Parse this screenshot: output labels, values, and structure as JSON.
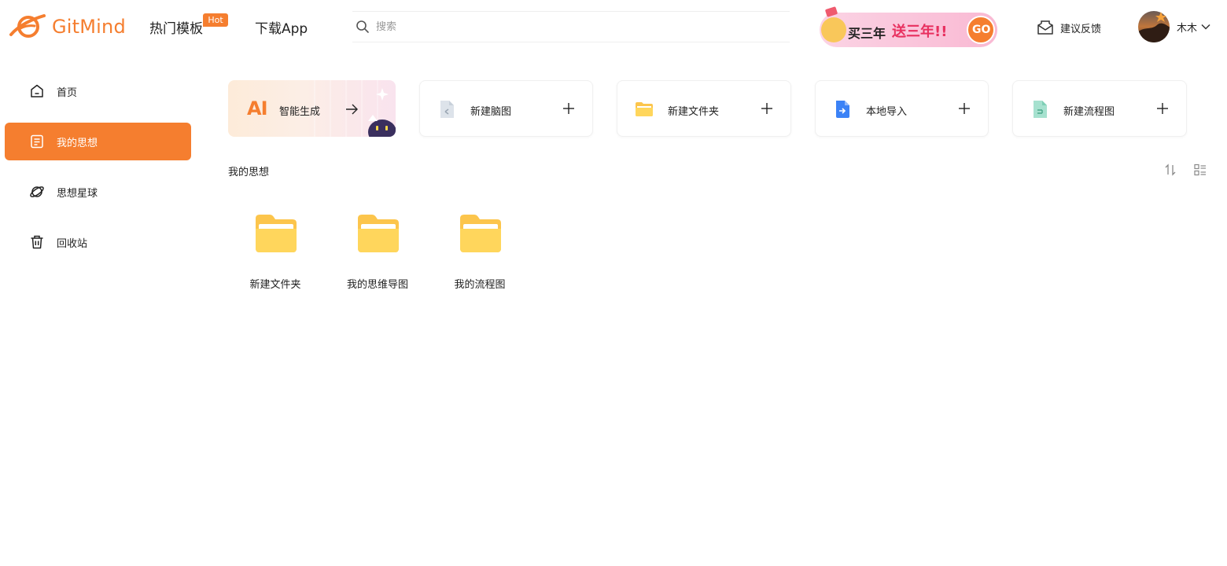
{
  "brand": {
    "name": "GitMind",
    "accent": "#f57e2f"
  },
  "nav": {
    "templates": "热门模板",
    "hot_badge": "Hot",
    "download": "下载App"
  },
  "search": {
    "placeholder": "搜索",
    "icon": "search-icon"
  },
  "promo": {
    "text_left": "买三年",
    "text_right": "送三年!!",
    "go": "GO"
  },
  "feedback": {
    "label": "建议反馈",
    "icon": "mail-icon"
  },
  "user": {
    "name": "木木"
  },
  "sidebar": {
    "items": [
      {
        "label": "首页",
        "icon": "home-icon",
        "active": false
      },
      {
        "label": "我的思想",
        "icon": "document-icon",
        "active": true
      },
      {
        "label": "思想星球",
        "icon": "planet-icon",
        "active": false
      },
      {
        "label": "回收站",
        "icon": "trash-icon",
        "active": false
      }
    ]
  },
  "quick": {
    "ai": {
      "badge": "AI",
      "label": "智能生成"
    },
    "cards": [
      {
        "label": "新建脑图",
        "icon": "mindmap-file-icon"
      },
      {
        "label": "新建文件夹",
        "icon": "folder-icon"
      },
      {
        "label": "本地导入",
        "icon": "import-file-icon"
      },
      {
        "label": "新建流程图",
        "icon": "flowchart-file-icon"
      }
    ]
  },
  "section": {
    "title": "我的思想"
  },
  "folders": [
    {
      "name": "新建文件夹"
    },
    {
      "name": "我的思维导图"
    },
    {
      "name": "我的流程图"
    }
  ]
}
